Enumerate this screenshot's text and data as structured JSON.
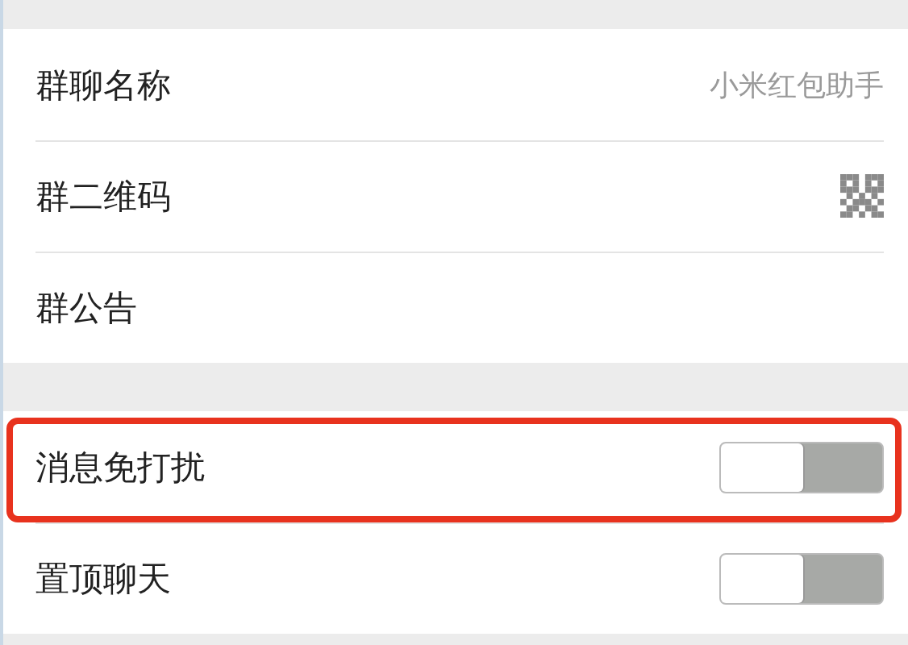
{
  "groups": [
    {
      "rows": [
        {
          "kind": "value",
          "label": "群聊名称",
          "value": "小米红包助手"
        },
        {
          "kind": "qr",
          "label": "群二维码"
        },
        {
          "kind": "plain",
          "label": "群公告"
        }
      ]
    },
    {
      "rows": [
        {
          "kind": "toggle",
          "label": "消息免打扰",
          "on": false,
          "highlighted": true
        },
        {
          "kind": "toggle",
          "label": "置顶聊天",
          "on": false,
          "highlighted": false
        }
      ]
    }
  ]
}
